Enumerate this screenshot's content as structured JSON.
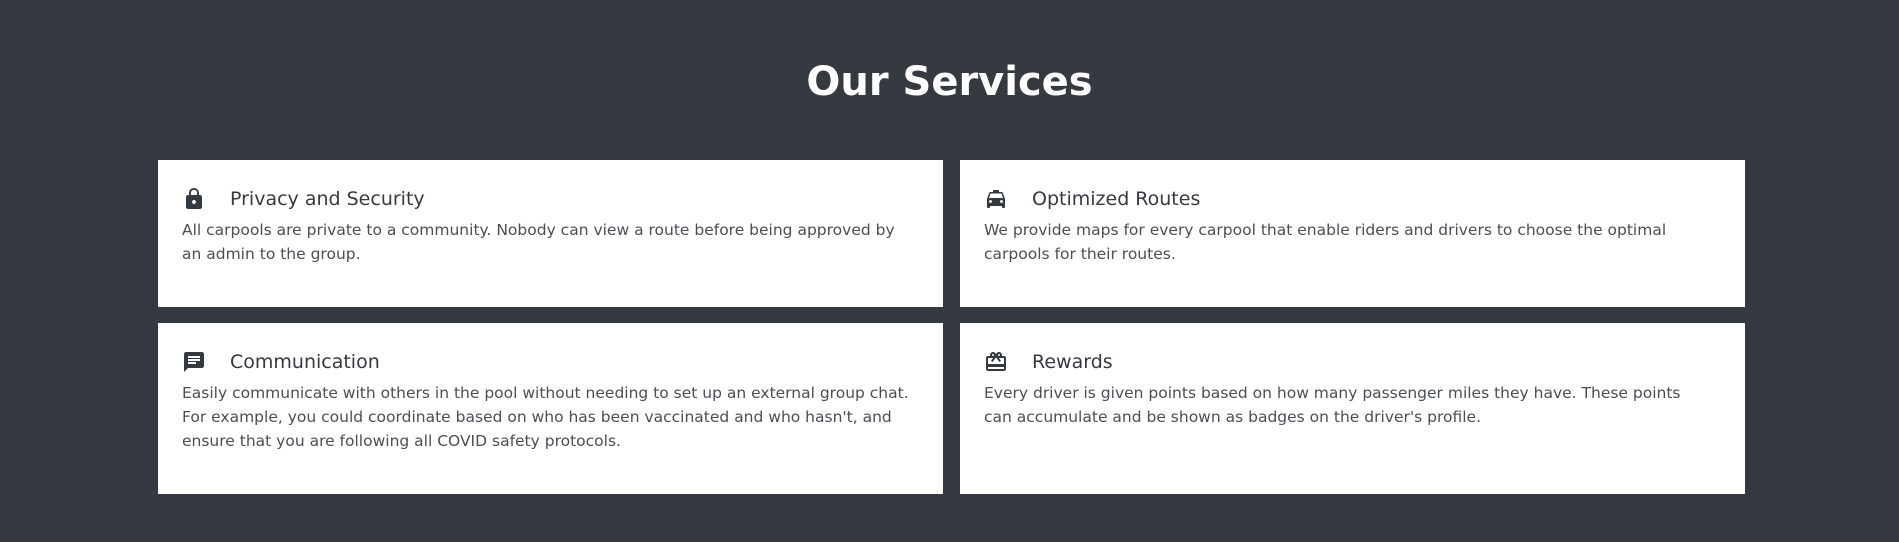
{
  "section": {
    "title": "Our Services"
  },
  "services": [
    {
      "icon": "lock-icon",
      "title": "Privacy and Security",
      "description": "All carpools are private to a community. Nobody can view a route before being approved by an admin to the group."
    },
    {
      "icon": "taxi-icon",
      "title": "Optimized Routes",
      "description": "We provide maps for every carpool that enable riders and drivers to choose the optimal carpools for their routes."
    },
    {
      "icon": "chat-icon",
      "title": "Communication",
      "description": "Easily communicate with others in the pool without needing to set up an external group chat. For example, you could coordinate based on who has been vaccinated and who hasn't, and ensure that you are following all COVID safety protocols."
    },
    {
      "icon": "redeem-icon",
      "title": "Rewards",
      "description": "Every driver is given points based on how many passenger miles they have. These points can accumulate and be shown as badges on the driver's profile."
    }
  ],
  "colors": {
    "background": "#343a40",
    "card": "#ffffff",
    "heading": "#ffffff",
    "text": "#343a40"
  }
}
